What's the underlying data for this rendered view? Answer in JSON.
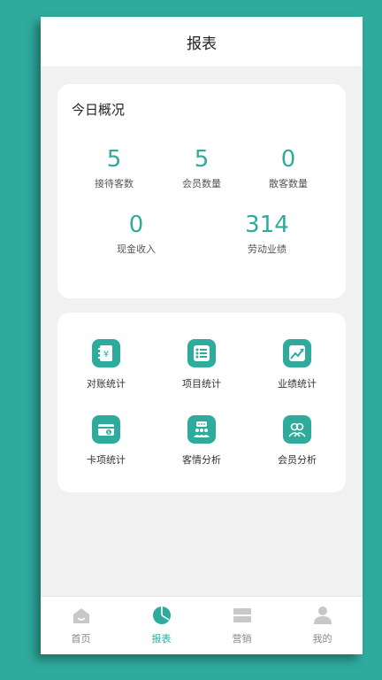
{
  "header": {
    "title": "报表"
  },
  "overview": {
    "title": "今日概况",
    "stats": [
      {
        "value": "5",
        "label": "接待客数"
      },
      {
        "value": "5",
        "label": "会员数量"
      },
      {
        "value": "0",
        "label": "散客数量"
      },
      {
        "value": "0",
        "label": "现金收入"
      },
      {
        "value": "314",
        "label": "劳动业绩"
      }
    ]
  },
  "menu": {
    "items": [
      {
        "label": "对账统计",
        "icon": "ledger-yen-icon"
      },
      {
        "label": "项目统计",
        "icon": "checklist-icon"
      },
      {
        "label": "业绩统计",
        "icon": "trend-chart-icon"
      },
      {
        "label": "卡项统计",
        "icon": "card-coin-icon"
      },
      {
        "label": "客情分析",
        "icon": "customer-chat-icon"
      },
      {
        "label": "会员分析",
        "icon": "members-icon"
      }
    ]
  },
  "tabbar": {
    "items": [
      {
        "label": "首页",
        "icon": "home-icon"
      },
      {
        "label": "报表",
        "icon": "pie-chart-icon"
      },
      {
        "label": "营销",
        "icon": "ticket-icon"
      },
      {
        "label": "我的",
        "icon": "user-icon"
      }
    ],
    "active_index": 1
  },
  "colors": {
    "accent": "#2fab9e",
    "inactive_icon": "#c8c8c8",
    "background": "#f1f1f1"
  }
}
